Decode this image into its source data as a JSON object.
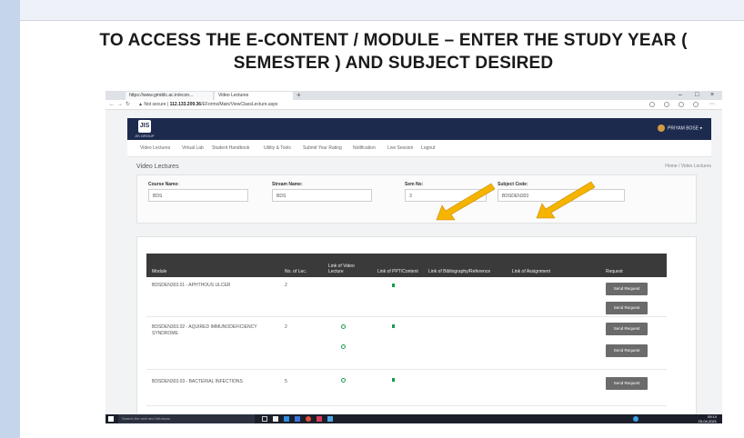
{
  "slide_title": "TO ACCESS THE E-CONTENT / MODULE – ENTER THE STUDY YEAR ( SEMESTER ) AND SUBJECT DESIRED",
  "browser": {
    "tab1": "https://www.gmddc.ac.in/econ...",
    "tab2": "Video Lectures",
    "new_tab": "+",
    "win_min": "–",
    "win_max": "□",
    "win_close": "×",
    "not_secure": "▲ Not secure",
    "url_host": "112.133.209.36",
    "url_path": "/EForms/Main/ViewClassLecture.aspx"
  },
  "app": {
    "logo_text": "JIS GROUP",
    "user_name": "PRIYAM BOSE ▾",
    "menu": [
      "Video Lectures",
      "Virtual Lab",
      "Student Handbook",
      "Utility & Tools",
      "Submit Your Rating",
      "Notification",
      "Live Session",
      "Logout"
    ],
    "page_title": "Video Lectures",
    "breadcrumb": "Home / Video Lectures"
  },
  "form": {
    "course_label": "Course Name:",
    "course_value": "BDS",
    "stream_label": "Stream Name:",
    "stream_value": "BDS",
    "sem_label": "Sem No:",
    "sem_value": "3",
    "subject_label": "Subject Code:",
    "subject_value": "BDSDEN303"
  },
  "table": {
    "headers": [
      "Module",
      "No. of Lec.",
      "Link of Video Lecture",
      "Link of PPT/Content",
      "Link of Bibliography/Reference",
      "Link of Assignment",
      "Request"
    ],
    "rows": [
      {
        "module": "BDSDEN303.01 - APHTHOUS ULCER",
        "lectures": "2"
      },
      {
        "module": "BDSDEN303.02 - AQUIRED IMMUNODEFICIENCY SYNDROME",
        "lectures": "2"
      },
      {
        "module": "BDSDEN303.03 - BACTERIAL INFECTIONS",
        "lectures": "5"
      }
    ],
    "send_label": "Send Request"
  },
  "taskbar": {
    "search_placeholder": "Search the web and Windows",
    "time": "09:14",
    "date": "25-04-2021"
  },
  "colors": {
    "header": "#1c2a4e",
    "table_head": "#3a3a3a",
    "arrow": "#f4b400",
    "link_green": "#1a9e4a",
    "left_band": "#c5d6ea"
  }
}
